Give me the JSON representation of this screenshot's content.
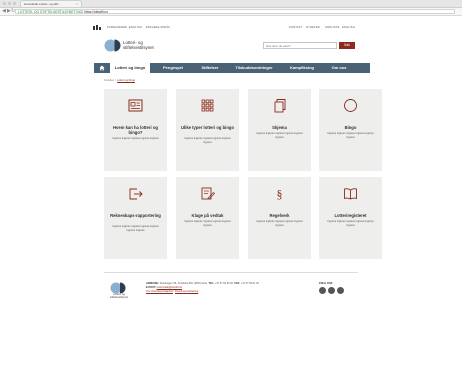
{
  "browser": {
    "tab_title": "Hovedside Lotteri- og stift...",
    "url_ssl": "LOTTERI- OG STIFTELSESTILSYNET [NO]",
    "url": "https://lottstift.no"
  },
  "utility": {
    "gov_logo": "LOGO",
    "links": [
      "FOREGÅENDE",
      "ENGLISH",
      "ENKLERE SPRÅK"
    ],
    "right_links": [
      "KONTAKT",
      "NYHETER",
      "ORDLISTE",
      "ENGLISH"
    ]
  },
  "header": {
    "logo_line1": "Lotteri- og",
    "logo_line2": "stiftelsestilsynet",
    "search_placeholder": "Hva leter du etter?",
    "search_button": "Søk"
  },
  "nav": {
    "items": [
      "Lotteri og bingo",
      "Pengespel",
      "Stiftelser",
      "Tilskuddsordninger",
      "Kampfiksing",
      "Om oss"
    ]
  },
  "breadcrumb": {
    "home": "Forsiden",
    "separator": ">",
    "current": "Lotteri og bingo"
  },
  "cards": [
    {
      "icon": "id-card-icon",
      "title": "Hvem kan ha lotteri og bingo?",
      "desc": "Ingress ingress ingress ingress ingress"
    },
    {
      "icon": "grid-icon",
      "title": "Ulike typer lotteri og bingo",
      "desc": "Ingress ingress ingress ingress ingress ingress"
    },
    {
      "icon": "documents-icon",
      "title": "Skjema",
      "desc": "Ingress ingress ingress ingress ingress ingress"
    },
    {
      "icon": "circle-icon",
      "title": "Bingo",
      "desc": "Ingress ingress ingress ingress ingress ingress"
    },
    {
      "icon": "export-icon",
      "title": "Rekneskaps-rapportering",
      "desc": "Ingress ingress ingress ingress ingress ingress ingress"
    },
    {
      "icon": "complaint-icon",
      "title": "Klage på vedtak",
      "desc": "Ingress ingress ingress ingress ingress ingress"
    },
    {
      "icon": "section-icon",
      "title": "Regelverk",
      "desc": "Ingress ingress ingress ingress ingress ingress"
    },
    {
      "icon": "book-icon",
      "title": "Lotteriregisteret",
      "desc": "Ingress ingress ingress ingress ingress ingress"
    }
  ],
  "footer": {
    "logo_line1": "Lotteri- og",
    "logo_line2": "stiftelsestilsynet",
    "address_label": "ADRESSE:",
    "address": "Storehagen 1B, Postboks 800, 6805 Førde",
    "phone_label": "TEL:",
    "phone": "+47 57 82 80 00",
    "fax_label": "FAX:",
    "fax": "+47 57 82 81 00",
    "email_label": "E-POST:",
    "email": "postmottak@lottstift.no",
    "link1": "Om informasjonskapsler",
    "link_sep": "|",
    "link2": "Personvernerklæring",
    "follow_label": "FØLG OSS",
    "social": [
      "facebook-icon",
      "twitter-icon",
      "flickr-icon"
    ]
  },
  "colors": {
    "brand": "#8b2a1d",
    "nav": "#4a6275",
    "card": "#eeeeec"
  }
}
